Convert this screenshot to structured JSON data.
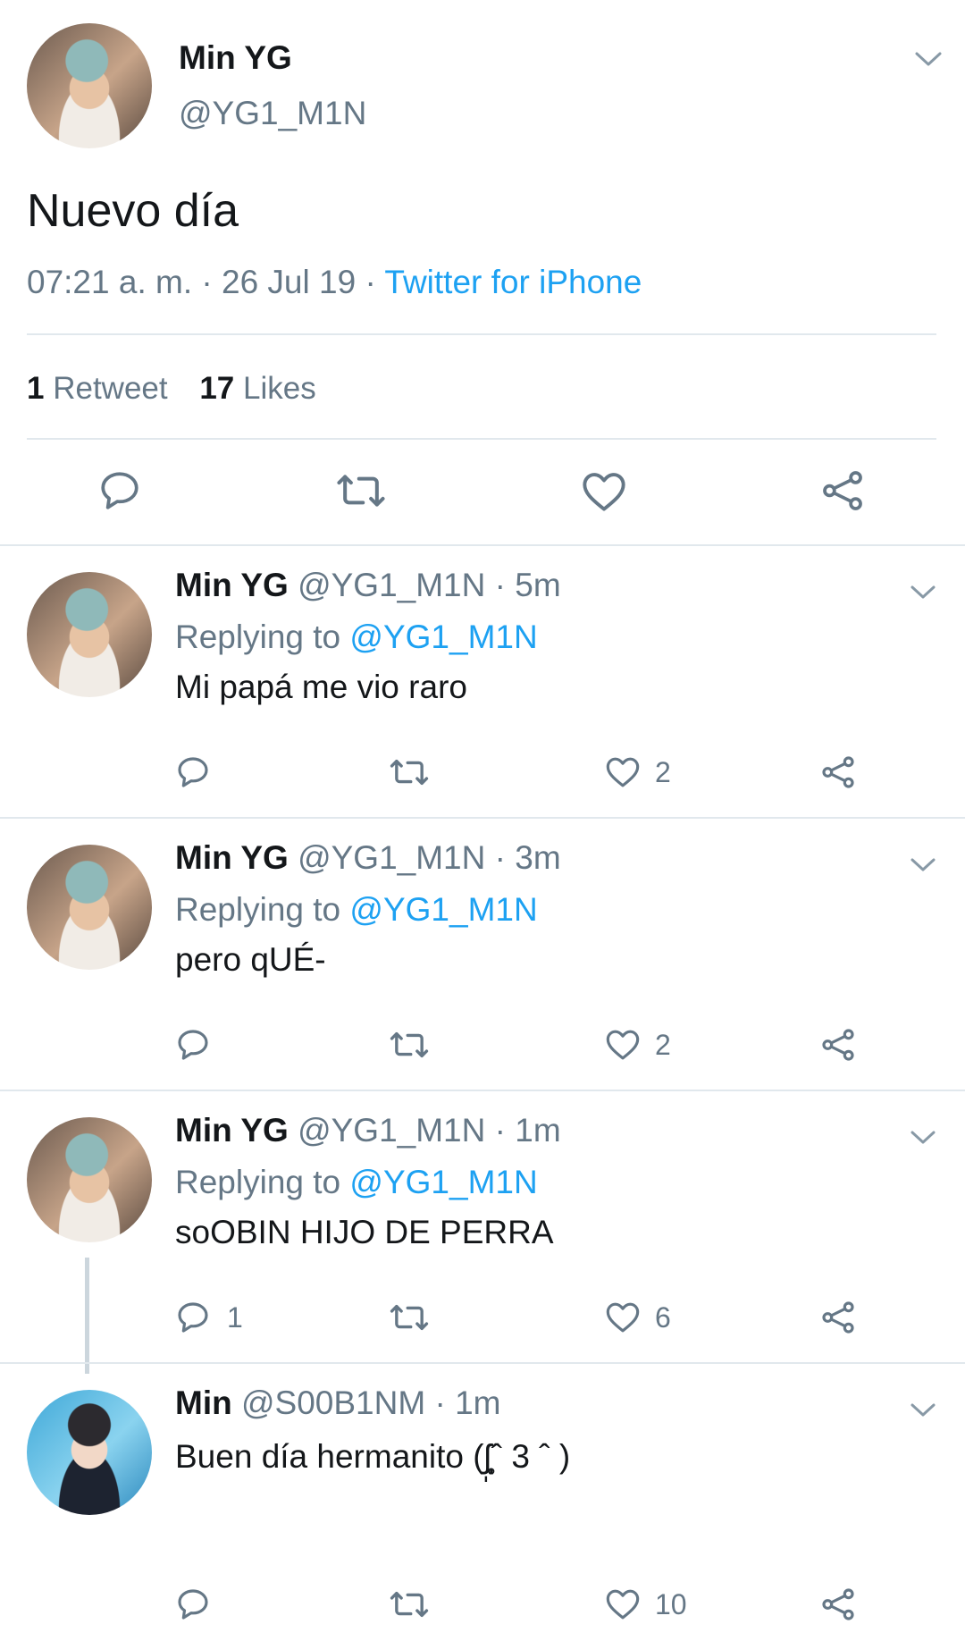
{
  "main_tweet": {
    "display_name": "Min YG",
    "handle": "@YG1_M1N",
    "text": "Nuevo día",
    "time": "07:21 a. m.",
    "sep1": "·",
    "date": "26 Jul 19",
    "sep2": "·",
    "source": "Twitter for iPhone",
    "retweet_count": "1",
    "retweet_label": "Retweet",
    "like_count": "17",
    "like_label": "Likes"
  },
  "replies": [
    {
      "display_name": "Min YG",
      "handle": "@YG1_M1N",
      "meta": "· 5m",
      "replying_label": "Replying to",
      "replying_handle": "@YG1_M1N",
      "text": "Mi papá me vio raro",
      "reply_count": "",
      "like_count": "2"
    },
    {
      "display_name": "Min YG",
      "handle": "@YG1_M1N",
      "meta": "· 3m",
      "replying_label": "Replying to",
      "replying_handle": "@YG1_M1N",
      "text": "pero qUÉ-",
      "reply_count": "",
      "like_count": "2"
    },
    {
      "display_name": "Min YG",
      "handle": "@YG1_M1N",
      "meta": "· 1m",
      "replying_label": "Replying to",
      "replying_handle": "@YG1_M1N",
      "text": "soOBIN HIJO DE PERRA",
      "reply_count": "1",
      "like_count": "6"
    },
    {
      "display_name": "Min",
      "handle": "@S00B1NM",
      "meta": "· 1m",
      "text": "Buen día hermanito (ʃ̩̩̥͙ˆ 3 ˆ )",
      "reply_count": "",
      "like_count": "10"
    }
  ],
  "colors": {
    "accent": "#1da1f2",
    "muted": "#657786",
    "divider": "#e1e8ed",
    "text": "#14171a"
  },
  "icons": [
    "chevron-down-icon",
    "reply-icon",
    "retweet-icon",
    "like-icon",
    "share-icon"
  ]
}
